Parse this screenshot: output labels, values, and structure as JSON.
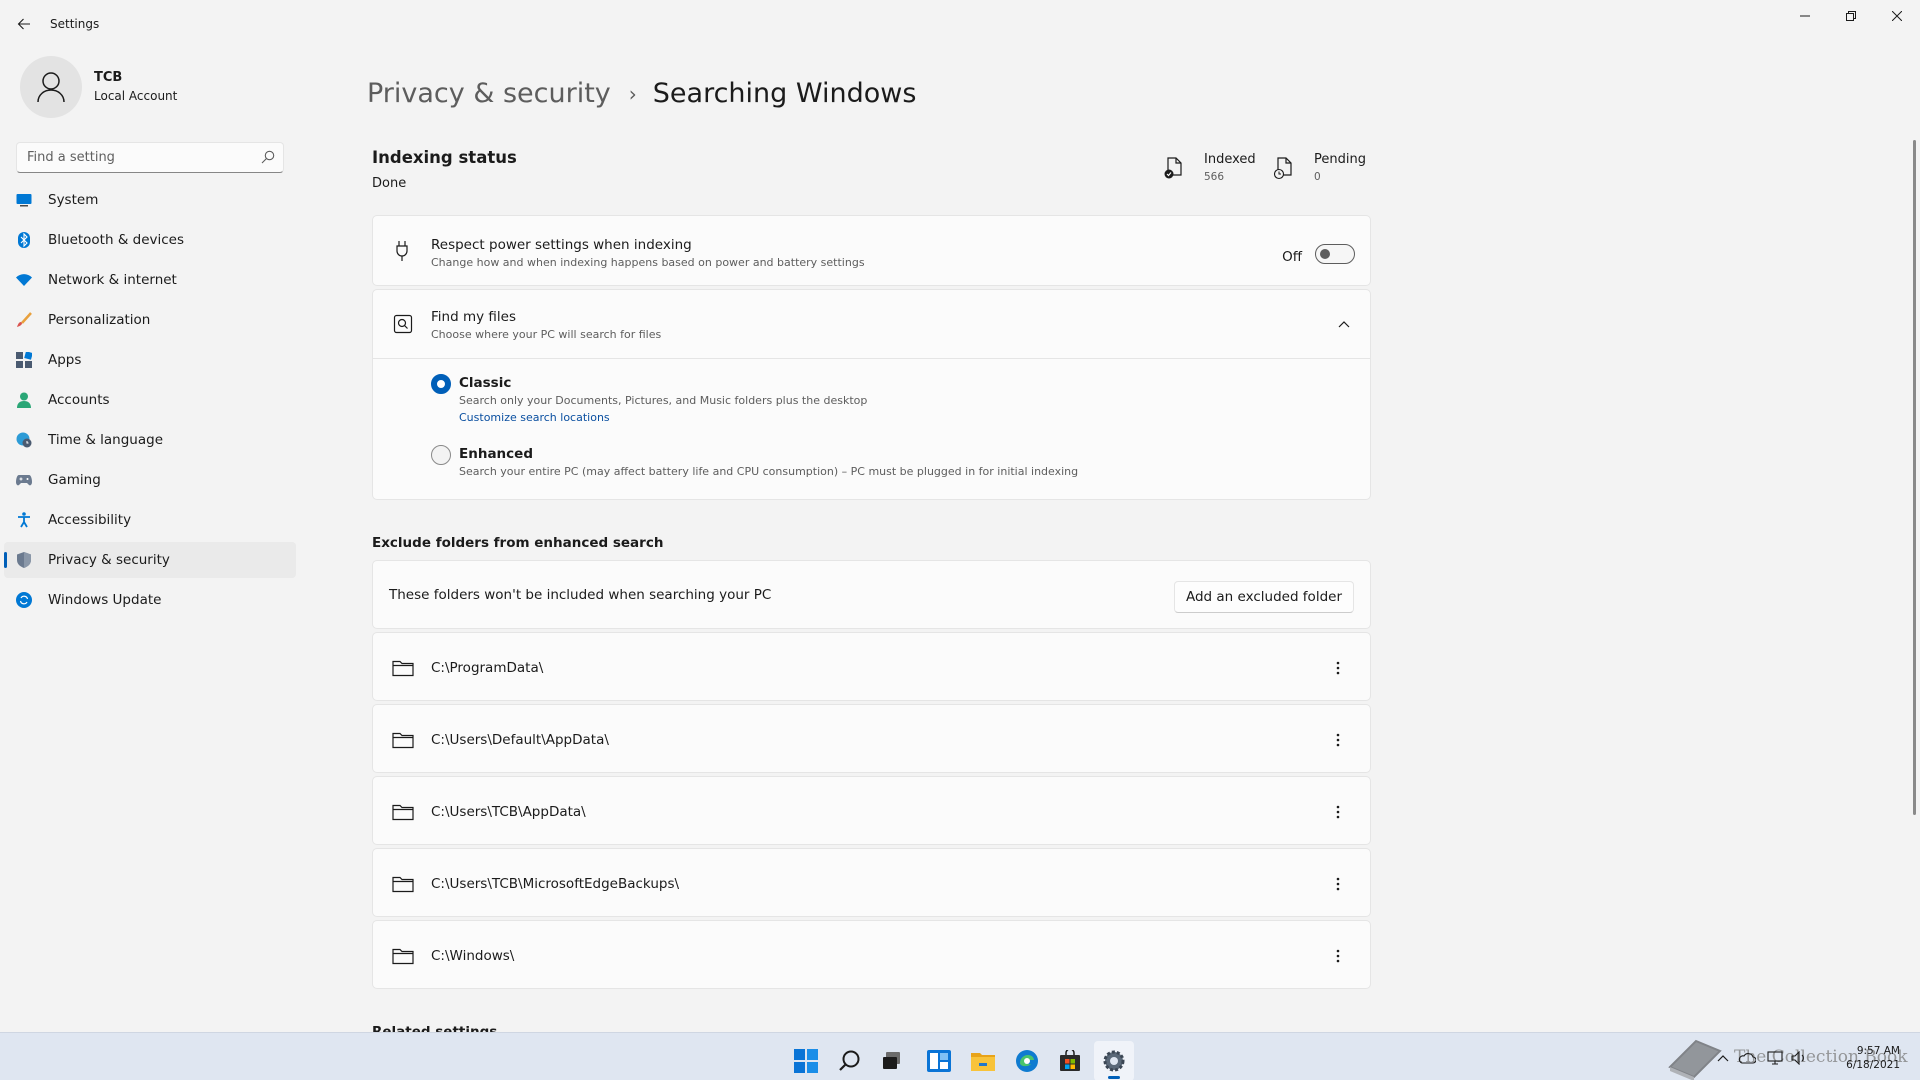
{
  "window": {
    "app_title": "Settings"
  },
  "profile": {
    "name": "TCB",
    "account_type": "Local Account"
  },
  "search": {
    "placeholder": "Find a setting"
  },
  "sidebar": {
    "items": [
      {
        "label": "System",
        "icon": "system-icon",
        "active": false
      },
      {
        "label": "Bluetooth & devices",
        "icon": "bluetooth-icon",
        "active": false
      },
      {
        "label": "Network & internet",
        "icon": "wifi-icon",
        "active": false
      },
      {
        "label": "Personalization",
        "icon": "brush-icon",
        "active": false
      },
      {
        "label": "Apps",
        "icon": "apps-icon",
        "active": false
      },
      {
        "label": "Accounts",
        "icon": "person-icon",
        "active": false
      },
      {
        "label": "Time & language",
        "icon": "globe-clock-icon",
        "active": false
      },
      {
        "label": "Gaming",
        "icon": "gamepad-icon",
        "active": false
      },
      {
        "label": "Accessibility",
        "icon": "accessibility-icon",
        "active": false
      },
      {
        "label": "Privacy & security",
        "icon": "shield-icon",
        "active": true
      },
      {
        "label": "Windows Update",
        "icon": "update-icon",
        "active": false
      }
    ]
  },
  "breadcrumb": {
    "parent": "Privacy & security",
    "separator": "›",
    "current": "Searching Windows"
  },
  "indexing": {
    "title": "Indexing status",
    "state": "Done",
    "indexed_label": "Indexed",
    "indexed_count": "566",
    "pending_label": "Pending",
    "pending_count": "0"
  },
  "power_setting": {
    "title": "Respect power settings when indexing",
    "description": "Change how and when indexing happens based on power and battery settings",
    "toggle_state": "Off"
  },
  "find_files": {
    "title": "Find my files",
    "description": "Choose where your PC will search for files",
    "options": [
      {
        "label": "Classic",
        "description": "Search only your Documents, Pictures, and Music folders plus the desktop",
        "selected": true,
        "link": "Customize search locations"
      },
      {
        "label": "Enhanced",
        "description": "Search your entire PC (may affect battery life and CPU consumption) – PC must be plugged in for initial indexing",
        "selected": false
      }
    ]
  },
  "exclude": {
    "section_title": "Exclude folders from enhanced search",
    "info_text": "These folders won't be included when searching your PC",
    "add_button": "Add an excluded folder",
    "folders": [
      "C:\\ProgramData\\",
      "C:\\Users\\Default\\AppData\\",
      "C:\\Users\\TCB\\AppData\\",
      "C:\\Users\\TCB\\MicrosoftEdgeBackups\\",
      "C:\\Windows\\"
    ]
  },
  "related": {
    "title": "Related settings"
  },
  "taskbar": {
    "apps": [
      "start-icon",
      "search-icon",
      "task-view-icon",
      "widgets-icon",
      "file-explorer-icon",
      "edge-icon",
      "store-icon",
      "settings-icon"
    ],
    "time": "9:57 AM",
    "date": "6/18/2021",
    "watermark": "The Collection Book"
  },
  "colors": {
    "accent": "#005fb8",
    "background": "#f3f3f3",
    "card": "#fbfbfb",
    "taskbar": "#dfe6f1"
  }
}
